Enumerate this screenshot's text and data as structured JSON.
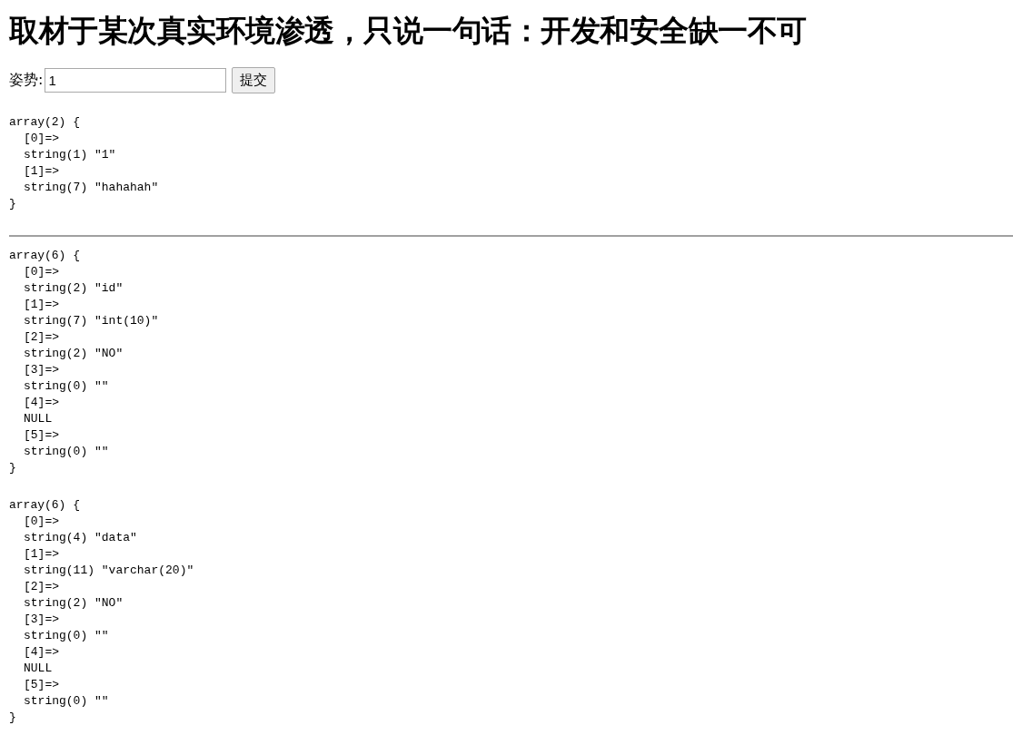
{
  "title": "取材于某次真实环境渗透，只说一句话：开发和安全缺一不可",
  "form": {
    "label": "姿势:",
    "input": {
      "value": "1"
    },
    "submit": "提交"
  },
  "query_dump": {
    "header": "array(2) {",
    "items": [
      "[0]=>",
      "string(1) \"1\"",
      "[1]=>",
      "string(7) \"hahahah\""
    ],
    "footer": "}"
  },
  "column_dumps": [
    {
      "header": "array(6) {",
      "items": [
        "[0]=>",
        "string(2) \"id\"",
        "[1]=>",
        "string(7) \"int(10)\"",
        "[2]=>",
        "string(2) \"NO\"",
        "[3]=>",
        "string(0) \"\"",
        "[4]=>",
        "NULL",
        "[5]=>",
        "string(0) \"\""
      ],
      "footer": "}"
    },
    {
      "header": "array(6) {",
      "items": [
        "[0]=>",
        "string(4) \"data\"",
        "[1]=>",
        "string(11) \"varchar(20)\"",
        "[2]=>",
        "string(2) \"NO\"",
        "[3]=>",
        "string(0) \"\"",
        "[4]=>",
        "NULL",
        "[5]=>",
        "string(0) \"\""
      ],
      "footer": "}"
    }
  ]
}
